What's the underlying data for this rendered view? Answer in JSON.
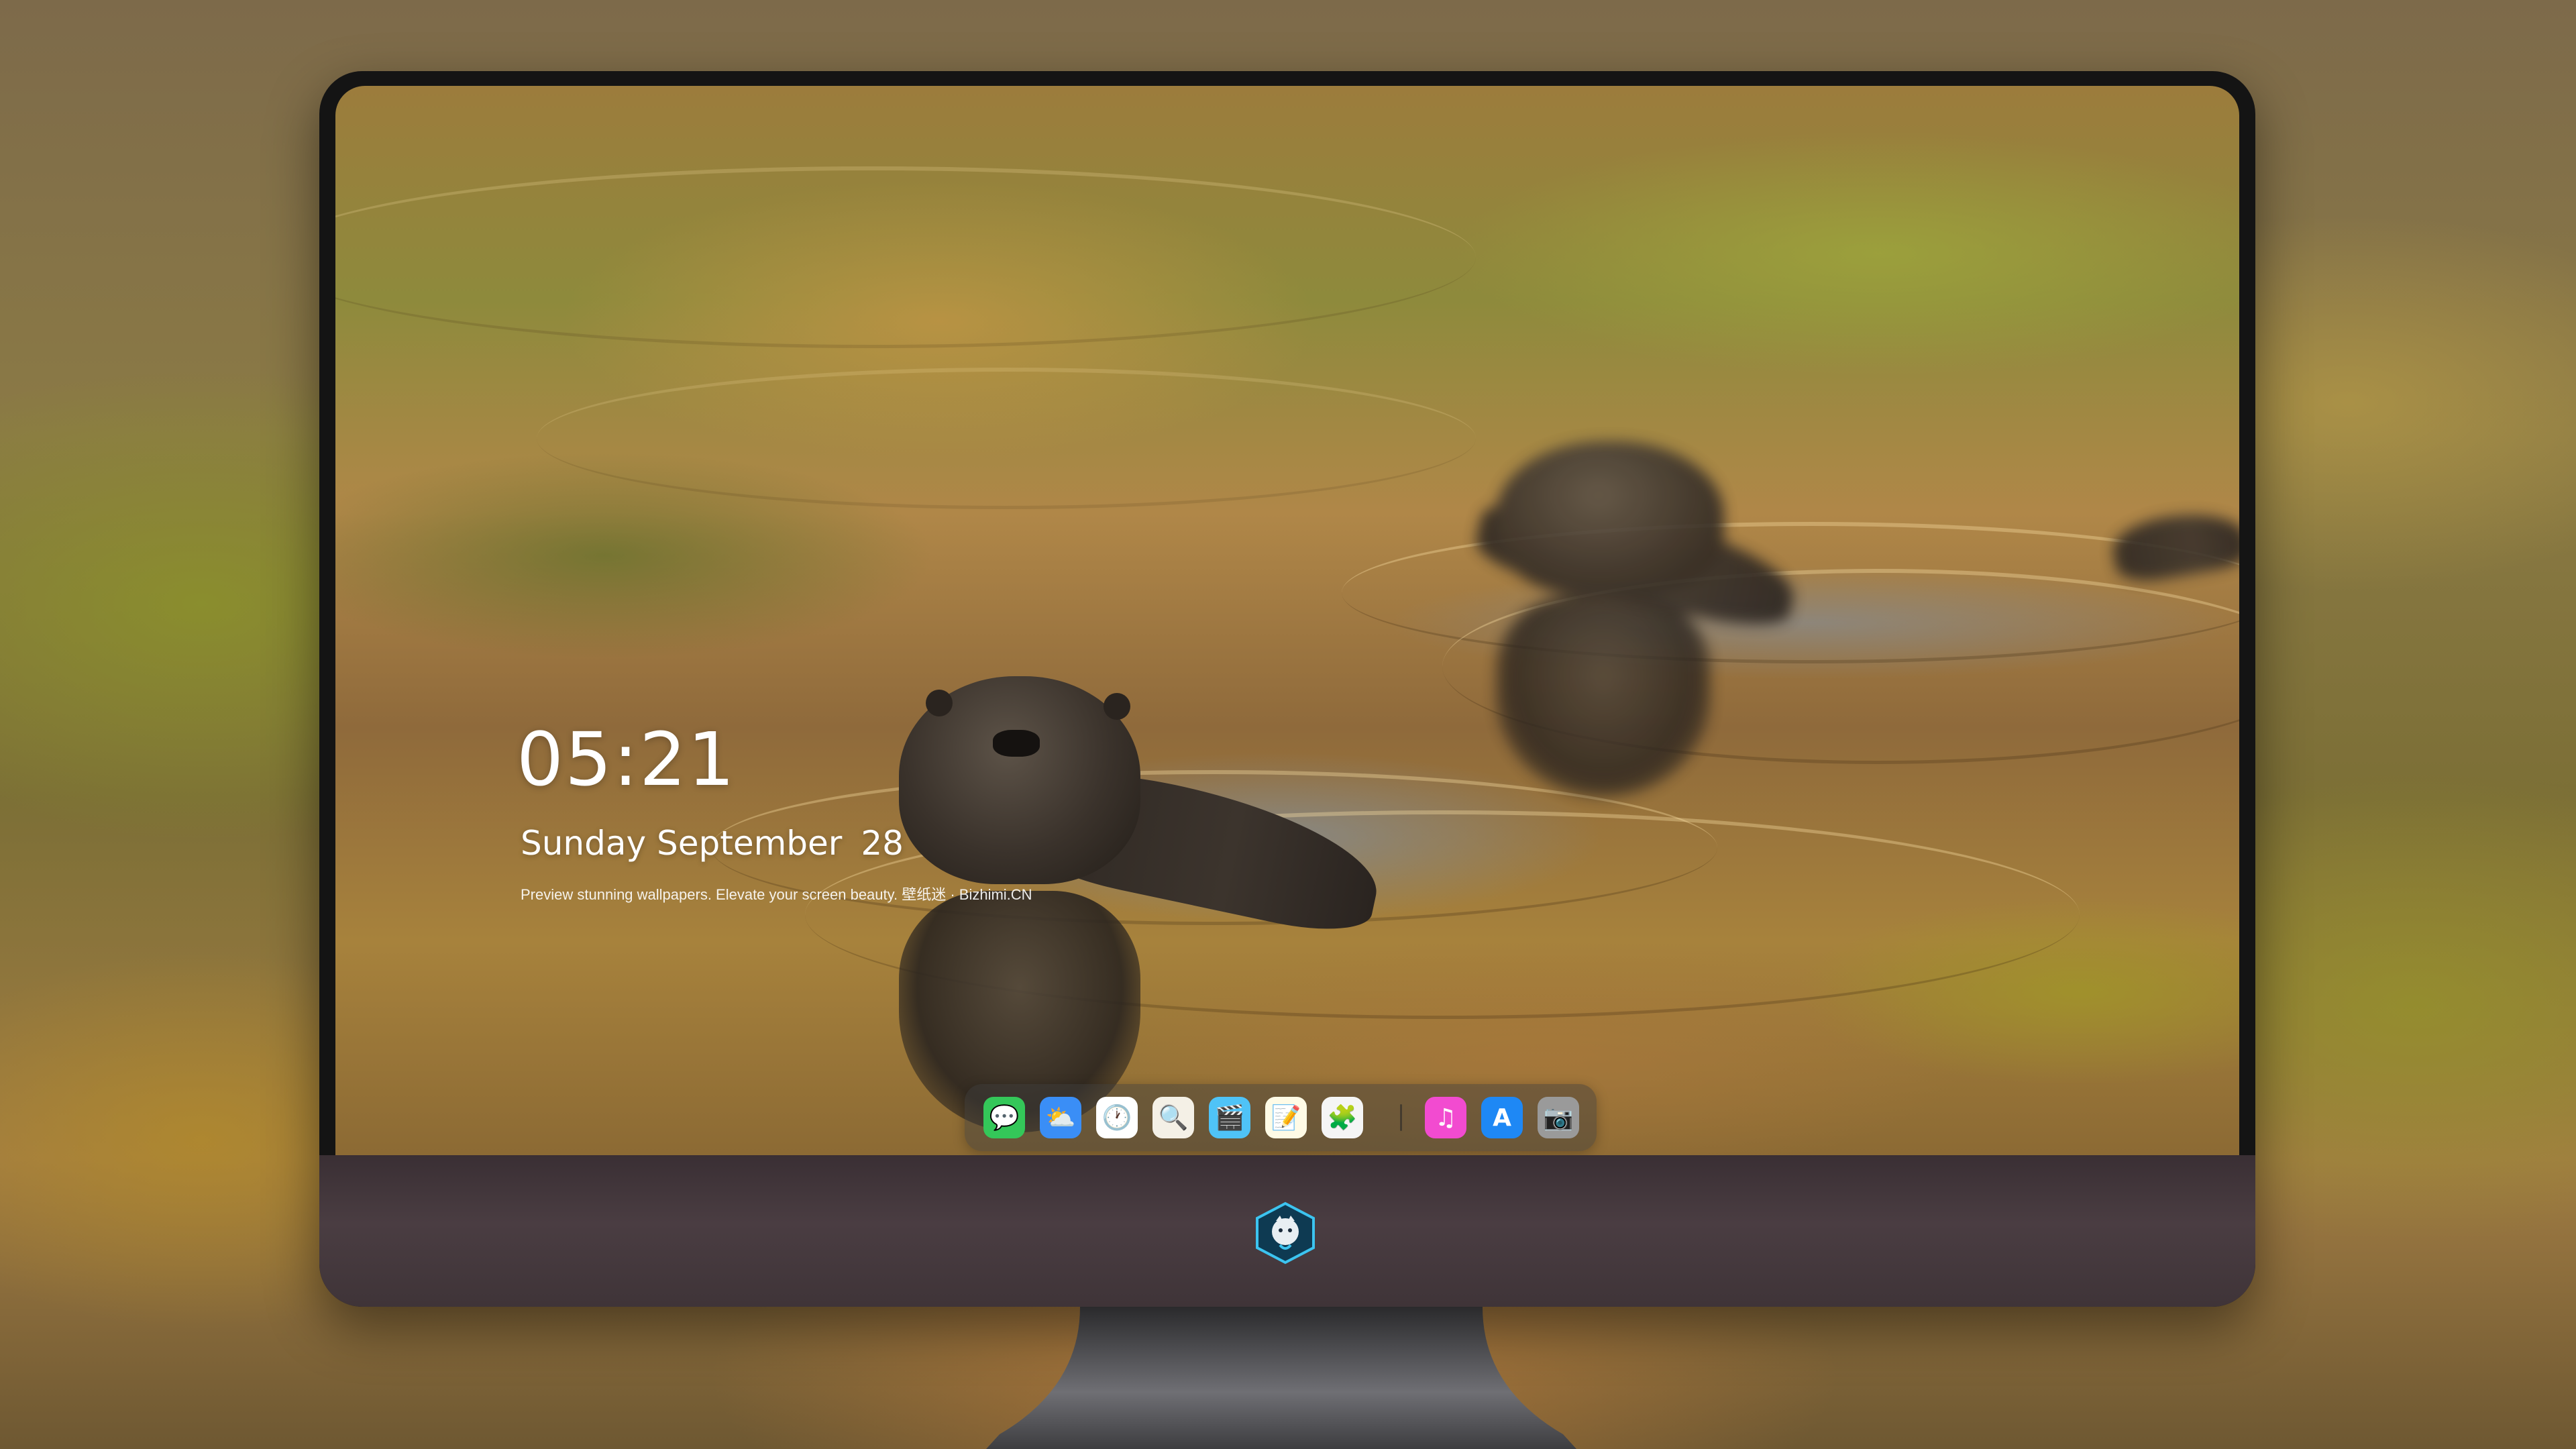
{
  "lock_screen": {
    "time": "05:21",
    "weekday_month": "Sunday September",
    "day": "28",
    "tagline": "Preview stunning wallpapers. Elevate your screen beauty. 壁纸迷 · Bizhimi.CN"
  },
  "dock": {
    "items": [
      {
        "name": "messages-icon",
        "glyph": "💬",
        "bg": "#34c759"
      },
      {
        "name": "weather-icon",
        "glyph": "⛅",
        "bg": "#3a8ef6"
      },
      {
        "name": "clock-icon",
        "glyph": "🕐",
        "bg": "#ffffff"
      },
      {
        "name": "preview-icon",
        "glyph": "🔍",
        "bg": "#f4f0e6"
      },
      {
        "name": "clips-icon",
        "glyph": "🎬",
        "bg": "#4fc3f7"
      },
      {
        "name": "notes-icon",
        "glyph": "📝",
        "bg": "#fffbe6"
      },
      {
        "name": "photo-booth-icon",
        "glyph": "🧩",
        "bg": "#f5f5f5"
      },
      {
        "name": "music-icon",
        "glyph": "♫",
        "bg": "#f24bd0"
      },
      {
        "name": "app-store-icon",
        "glyph": "A",
        "bg": "#1e88f5"
      },
      {
        "name": "camera-icon",
        "glyph": "📷",
        "bg": "#9a9a9a"
      }
    ]
  },
  "colors": {
    "dock_background": "#3c3c3c",
    "chin": "#44383d",
    "bezel": "#141414"
  }
}
